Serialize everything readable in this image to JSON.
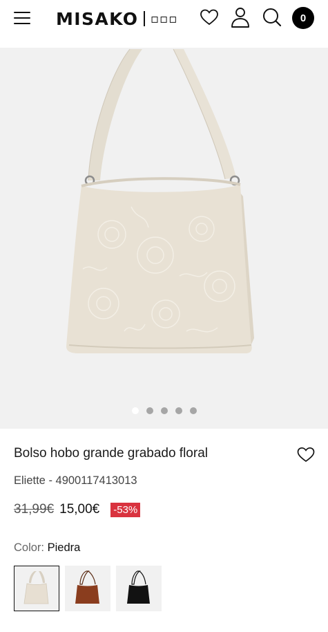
{
  "header": {
    "brand": "MISAKO",
    "flag": "▫▫▫",
    "cart_count": "0",
    "icons": [
      "menu-icon",
      "heart-icon",
      "user-icon",
      "search-icon",
      "cart-icon"
    ]
  },
  "gallery": {
    "image_count": 5,
    "active_index": 0
  },
  "product": {
    "title": "Bolso hobo grande grabado floral",
    "reference": "Eliette - 4900117413013",
    "old_price": "31,99€",
    "price": "15,00€",
    "discount": "-53%",
    "color_label": "Color:",
    "color_value": "Piedra",
    "swatches": [
      {
        "color": "#e7dfd2",
        "selected": true
      },
      {
        "color": "#8a3d1e",
        "selected": false
      },
      {
        "color": "#121212",
        "selected": false
      }
    ]
  },
  "colors": {
    "discount_badge": "#d9333f",
    "cart_badge": "#000000"
  }
}
